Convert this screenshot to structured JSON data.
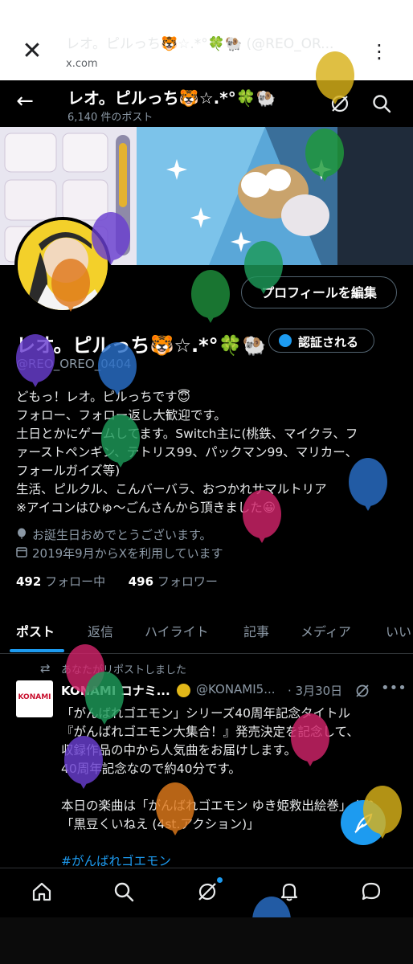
{
  "browser": {
    "close_icon": "close-icon",
    "title": "レオ。ピルっち🐯☆.*°🍀🐏 (@REO_OR...",
    "domain": "x.com",
    "menu_icon": "kebab-menu-icon"
  },
  "header": {
    "name": "レオ。ピルっち🐯☆.*°🍀🐏",
    "posts_count": "6,140 件のポスト"
  },
  "profile": {
    "edit_button": "プロフィールを編集",
    "display_name": "レオ。ピルっち🐯☆.*°🍀🐏",
    "verify_button": "認証される",
    "handle": "@REO_OREO_0404",
    "bio": [
      "どもっ！レオ。ピルっちです😇",
      " フォロー、フォロー返し大歓迎です。",
      "土日とかにゲームしてます。Switch主に(桃鉄、マイクラ、フ",
      "ァーストペンギン、テトリス99、パックマン99、マリカー、",
      "フォールガイズ等)",
      "生活、ピルクル、こんバーバラ、おつかれサマルトリア",
      "※アイコンはひゅ～ごんさんから頂きました😀"
    ],
    "birthday": "お誕生日おめでとうございます。",
    "joined": "2019年9月からXを利用しています",
    "following_count": "492",
    "following_label": "フォロー中",
    "followers_count": "496",
    "followers_label": "フォロワー"
  },
  "tabs": [
    "ポスト",
    "返信",
    "ハイライト",
    "記事",
    "メディア",
    "いい"
  ],
  "tweet": {
    "repost_label": "あなたがリポストしました",
    "avatar_text": "KONAMI",
    "author": "KONAMI コナミ...",
    "handle": "@KONAMI5...",
    "date": "· 3月30日",
    "lines": [
      "「がんばれゴエモン」シリーズ40周年記念タイトル",
      "『がんばれゴエモン大集合！』発売決定を記念して、",
      "収録作品の中から人気曲をお届けします。",
      "40周年記念なので約40分です。",
      "",
      "本日の楽曲は「がんばれゴエモン ゆき姫救出絵巻」より",
      "「黒豆くいねえ (4st.アクション)」",
      "",
      "#がんばれゴエモン"
    ]
  },
  "nav": [
    "home-icon",
    "search-icon",
    "grok-icon",
    "notifications-icon",
    "messages-icon"
  ],
  "colors": {
    "accent": "#1d9bf0",
    "background": "#000000",
    "muted_text": "#8b98a5"
  }
}
